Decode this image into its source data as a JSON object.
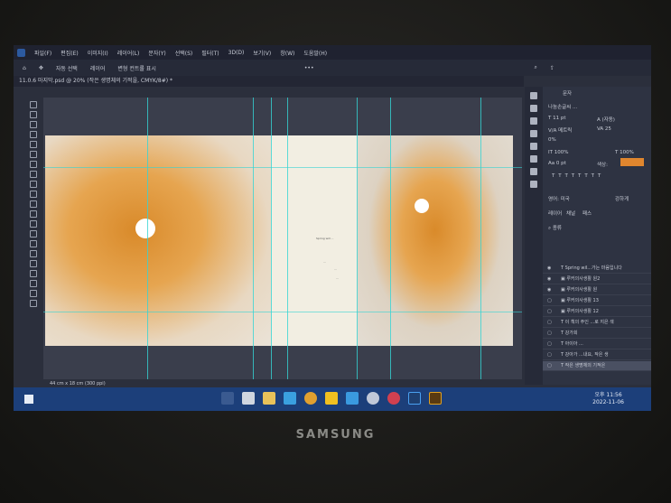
{
  "menu": [
    "파일(F)",
    "편집(E)",
    "이미지(I)",
    "레이어(L)",
    "문자(Y)",
    "선택(S)",
    "필터(T)",
    "3D(D)",
    "보기(V)",
    "창(W)",
    "도움말(H)"
  ],
  "options": {
    "auto_select": "자동 선택",
    "layer": "레이어",
    "show_transform": "변형 컨트롤 표시"
  },
  "document_tab": "11.0.6 마지막.psd @ 20% (작은 생명체의 기적을, CMYK/8#) *",
  "status": "44 cm x 18 cm (300 ppi)",
  "page_text": [
    "Spring will ... ",
    "...",
    "...",
    "..."
  ],
  "character_panel": {
    "title": "문자",
    "font": "나눔손글씨 ...",
    "size": "11 pt",
    "leading": "(자동)",
    "kerning": "메트릭",
    "tracking": "25",
    "scale_pct": "0%",
    "vscale": "100%",
    "hscale": "100%",
    "baseline": "0 pt",
    "color_label": "색상:",
    "color": "#e0862e",
    "language": "영어: 미국",
    "aa": "강하게"
  },
  "layers_panel": {
    "tabs": [
      "레이어",
      "채널",
      "패스"
    ],
    "filter": "종류",
    "layers": [
      {
        "name": "Spring wil...가는 마음입니다",
        "type": "text",
        "visible": true
      },
      {
        "name": "루커의사생활 원2",
        "type": "image",
        "visible": true
      },
      {
        "name": "루커의사생활 원",
        "type": "image",
        "visible": true
      },
      {
        "name": "루커의사생활 13",
        "type": "image",
        "visible": false
      },
      {
        "name": "루커의사생활 12",
        "type": "image",
        "visible": false
      },
      {
        "name": "이 책의 주인 ...로 지은 색",
        "type": "text",
        "visible": false
      },
      {
        "name": "강가희",
        "type": "text",
        "visible": false
      },
      {
        "name": "아이아 ...",
        "type": "text",
        "visible": false
      },
      {
        "name": "강아가 ...내요, 작은 생",
        "type": "text",
        "visible": false
      },
      {
        "name": "작은 생명체의 기적은",
        "type": "text",
        "visible": false,
        "selected": true
      }
    ]
  },
  "taskbar": {
    "time": "오후 11:56",
    "date": "2022-11-06"
  },
  "brand": "SAMSUNG"
}
